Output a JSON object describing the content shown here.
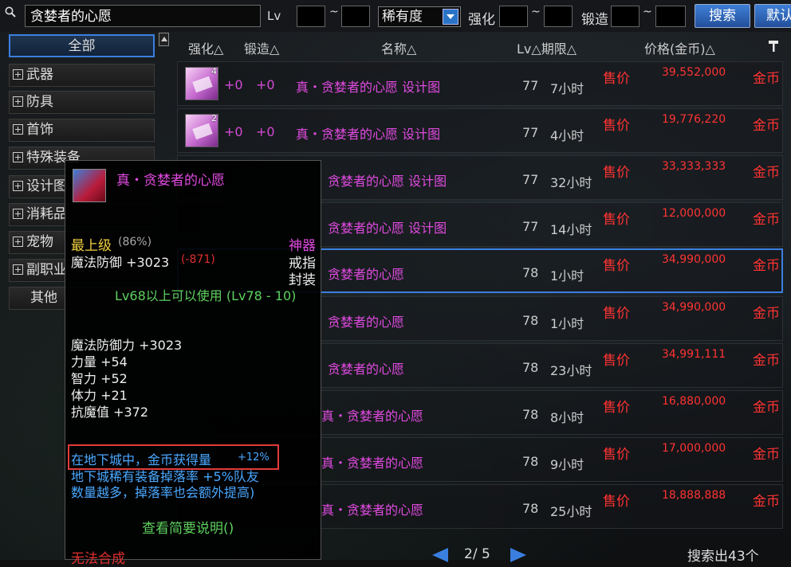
{
  "search": {
    "value": "贪婪者的心愿"
  },
  "filters": {
    "lv_label": "Lv",
    "tilde": "~",
    "rarity_label": "稀有度",
    "enhance_label": "强化",
    "forge_label": "锻造"
  },
  "buttons": {
    "search": "搜索",
    "default": "默认"
  },
  "sidebar": {
    "items": [
      {
        "label": "全部"
      },
      {
        "label": "武器"
      },
      {
        "label": "防具"
      },
      {
        "label": "首饰"
      },
      {
        "label": "特殊装备"
      },
      {
        "label": "设计图"
      },
      {
        "label": "消耗品"
      },
      {
        "label": "宠物"
      },
      {
        "label": "副职业"
      },
      {
        "label": "其他"
      }
    ]
  },
  "headers": {
    "enhance": "强化△",
    "forge": "锻造△",
    "name": "名称△",
    "lv_term": "Lv△期限△",
    "price": "价格(金币)△"
  },
  "rows": [
    {
      "qty": "4",
      "enh": "+0",
      "forge": "+0",
      "name": "真・贪婪者的心愿  设计图",
      "lv": "77",
      "dur": "7小时",
      "sell": "售价",
      "price": "39,552,000",
      "cur": "金币"
    },
    {
      "qty": "2",
      "enh": "+0",
      "forge": "+0",
      "name": "真・贪婪者的心愿  设计图",
      "lv": "77",
      "dur": "4小时",
      "sell": "售价",
      "price": "19,776,220",
      "cur": "金币"
    },
    {
      "qty": "",
      "enh": "",
      "forge": "",
      "name": "贪婪者的心愿  设计图",
      "lv": "77",
      "dur": "32小时",
      "sell": "售价",
      "price": "33,333,333",
      "cur": "金币"
    },
    {
      "qty": "",
      "enh": "",
      "forge": "",
      "name": "贪婪者的心愿  设计图",
      "lv": "77",
      "dur": "14小时",
      "sell": "售价",
      "price": "12,000,000",
      "cur": "金币"
    },
    {
      "qty": "",
      "enh": "",
      "forge": "",
      "name": "贪婪者的心愿",
      "lv": "78",
      "dur": "1小时",
      "sell": "售价",
      "price": "34,990,000",
      "cur": "金币"
    },
    {
      "qty": "",
      "enh": "",
      "forge": "",
      "name": "贪婪者的心愿",
      "lv": "78",
      "dur": "1小时",
      "sell": "售价",
      "price": "34,990,000",
      "cur": "金币"
    },
    {
      "qty": "",
      "enh": "",
      "forge": "",
      "name": "贪婪者的心愿",
      "lv": "78",
      "dur": "23小时",
      "sell": "售价",
      "price": "34,991,111",
      "cur": "金币"
    },
    {
      "qty": "",
      "enh": "",
      "forge": "",
      "name": "真・贪婪者的心愿",
      "lv": "78",
      "dur": "8小时",
      "sell": "售价",
      "price": "16,880,000",
      "cur": "金币"
    },
    {
      "qty": "",
      "enh": "",
      "forge": "",
      "name": "真・贪婪者的心愿",
      "lv": "78",
      "dur": "9小时",
      "sell": "售价",
      "price": "17,000,000",
      "cur": "金币"
    },
    {
      "qty": "",
      "enh": "",
      "forge": "",
      "name": "真・贪婪者的心愿",
      "lv": "78",
      "dur": "25小时",
      "sell": "售价",
      "price": "18,888,888",
      "cur": "金币"
    }
  ],
  "tooltip": {
    "title": "真・贪婪者的心愿",
    "grade": "最上级",
    "grade_pct": "(86%)",
    "rarity": "神器",
    "slot": "戒指",
    "seal": "封装",
    "mdef": "魔法防御 +3023",
    "mdef_diff": "(-871)",
    "level_req": "Lv68以上可以使用 (Lv78 - 10)",
    "stats": [
      "魔法防御力 +3023",
      "力量 +54",
      "智力 +52",
      "体力 +21",
      "抗魔值 +372"
    ],
    "bonus_line1_a": "在地下城中，金币获得量",
    "bonus_line1_b": "+12%",
    "bonus_line2": "地下城稀有装备掉落率 +5%队友",
    "bonus_line3": "数量越多，掉落率也会额外提高)",
    "brief": "查看简要说明()",
    "no_combine": "无法合成"
  },
  "pagination": {
    "page": "2/ 5",
    "result_count": "搜索出43个"
  },
  "colors": {
    "accent": "#3b7fe0",
    "price": "#ff3333",
    "name": "#e04ae0",
    "highlight": "#e23b3b"
  }
}
